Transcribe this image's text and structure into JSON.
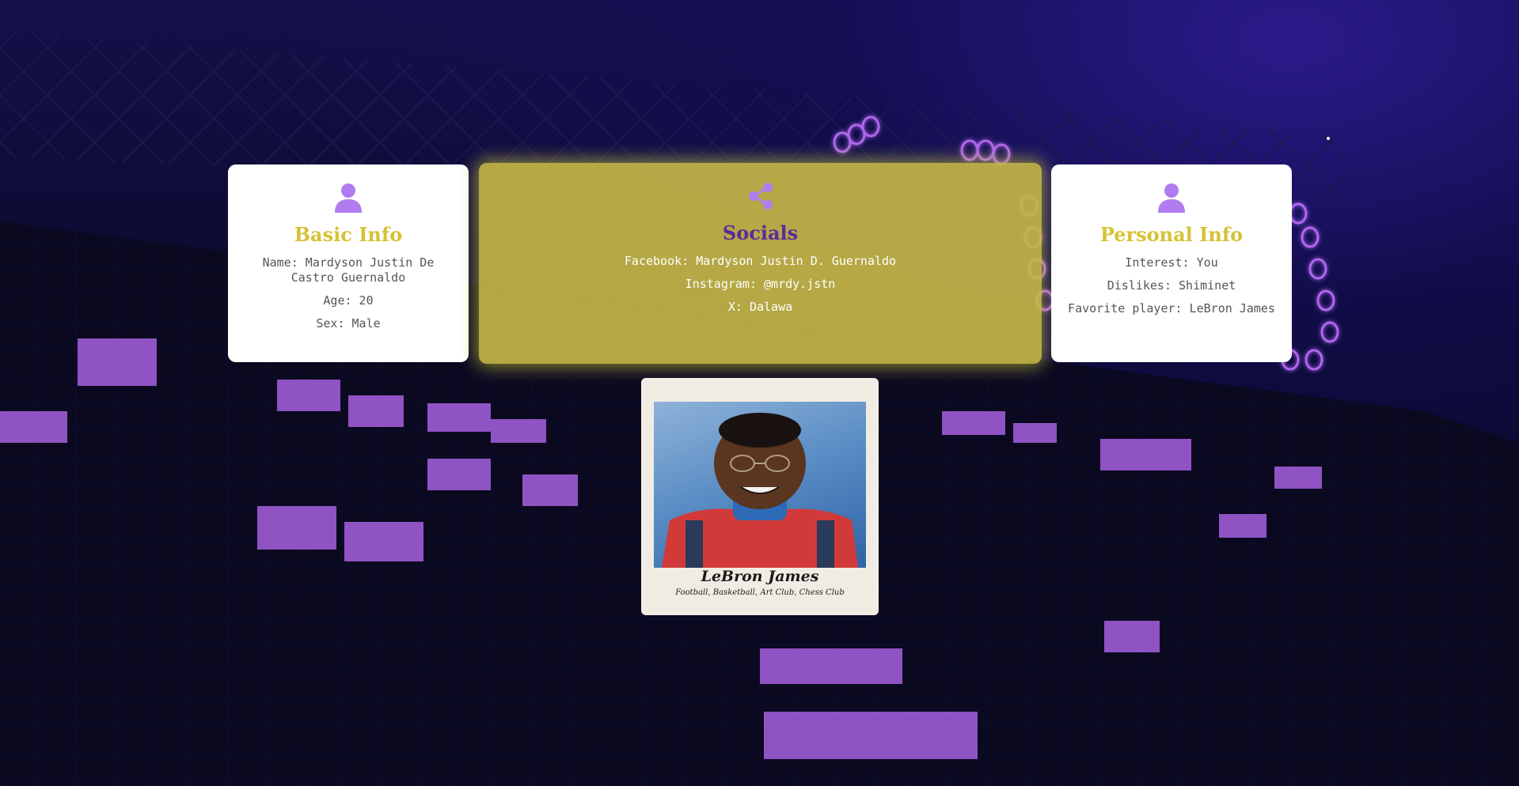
{
  "basic_info": {
    "icon": "user-icon",
    "title": "Basic Info",
    "lines": [
      "Name: Mardyson Justin De Castro Guernaldo",
      "Age: 20",
      "Sex: Male"
    ]
  },
  "socials": {
    "icon": "share-icon",
    "title": "Socials",
    "lines": [
      "Facebook: Mardyson Justin D. Guernaldo",
      "Instagram: @mrdy.jstn",
      "X: Dalawa"
    ]
  },
  "personal_info": {
    "icon": "user-icon",
    "title": "Personal Info",
    "lines": [
      "Interest: You",
      "Dislikes: Shiminet",
      "Favorite player: LeBron James"
    ]
  },
  "photo": {
    "name": "LeBron James",
    "clubs": "Football, Basketball, Art Club, Chess Club"
  },
  "colors": {
    "accent_purple": "#b07cf0",
    "title_gold": "#d6c234",
    "socials_bg": "#c8b946",
    "socials_title": "#5c2a9a"
  }
}
